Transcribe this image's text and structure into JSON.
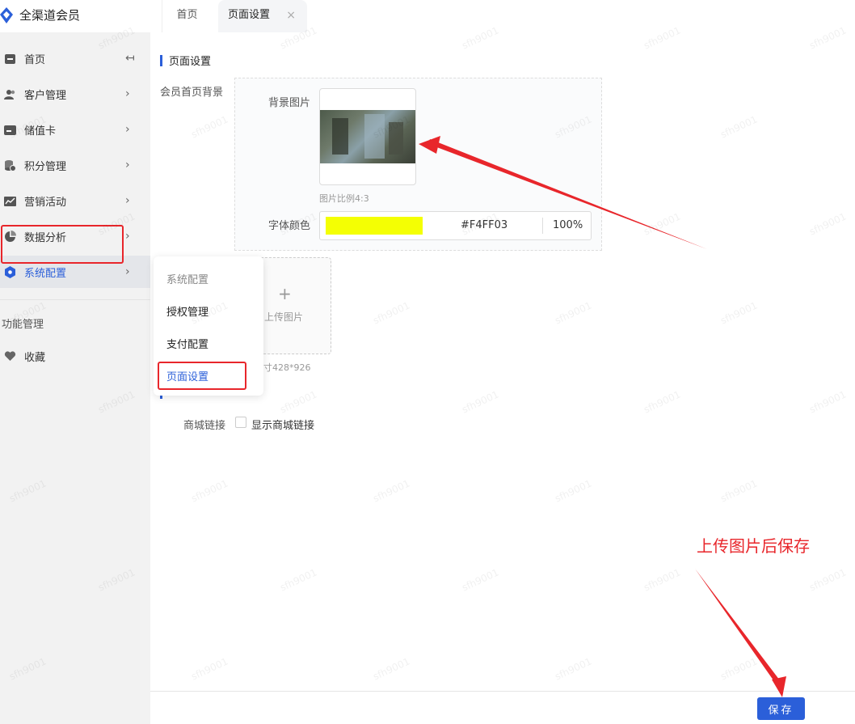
{
  "app": {
    "title": "全渠道会员",
    "brand_color": "#2b5fd9"
  },
  "tabs": [
    {
      "label": "首页"
    },
    {
      "label": "页面设置",
      "close": "×"
    }
  ],
  "sidebar": {
    "items": [
      {
        "label": "首页",
        "icon": "home-icon",
        "arrow": "↤"
      },
      {
        "label": "客户管理",
        "icon": "users-icon",
        "arrow": "›"
      },
      {
        "label": "储值卡",
        "icon": "card-icon",
        "arrow": "›"
      },
      {
        "label": "积分管理",
        "icon": "coins-icon",
        "arrow": "›"
      },
      {
        "label": "营销活动",
        "icon": "chart-line-icon",
        "arrow": "›"
      },
      {
        "label": "数据分析",
        "icon": "pie-chart-icon",
        "arrow": "›"
      },
      {
        "label": "系统配置",
        "icon": "hexagon-settings-icon",
        "arrow": "›"
      }
    ],
    "section_label": "功能管理",
    "favorites": {
      "label": "收藏",
      "icon": "heart-icon"
    }
  },
  "flyout": {
    "header": "系统配置",
    "items": [
      "授权管理",
      "支付配置",
      "页面设置"
    ]
  },
  "main": {
    "section_title": "页面设置",
    "bg_label": "会员首页背景",
    "bg_image_label": "背景图片",
    "bg_image_hint": "图片比例4:3",
    "font_color_label": "字体颜色",
    "font_color_hex": "#F4FF03",
    "font_color_opacity": "100%",
    "swatch_color": "#F4FF03",
    "upload_plus": "+",
    "upload_label": "上传图片",
    "upload_hint": "寸428*926",
    "mall_link_label": "商城链接",
    "mall_link_checkbox": "显示商城链接",
    "save_label": "保存"
  },
  "annotation": {
    "text": "上传图片后保存",
    "color": "#e8262b"
  },
  "watermark": "sfh9001"
}
